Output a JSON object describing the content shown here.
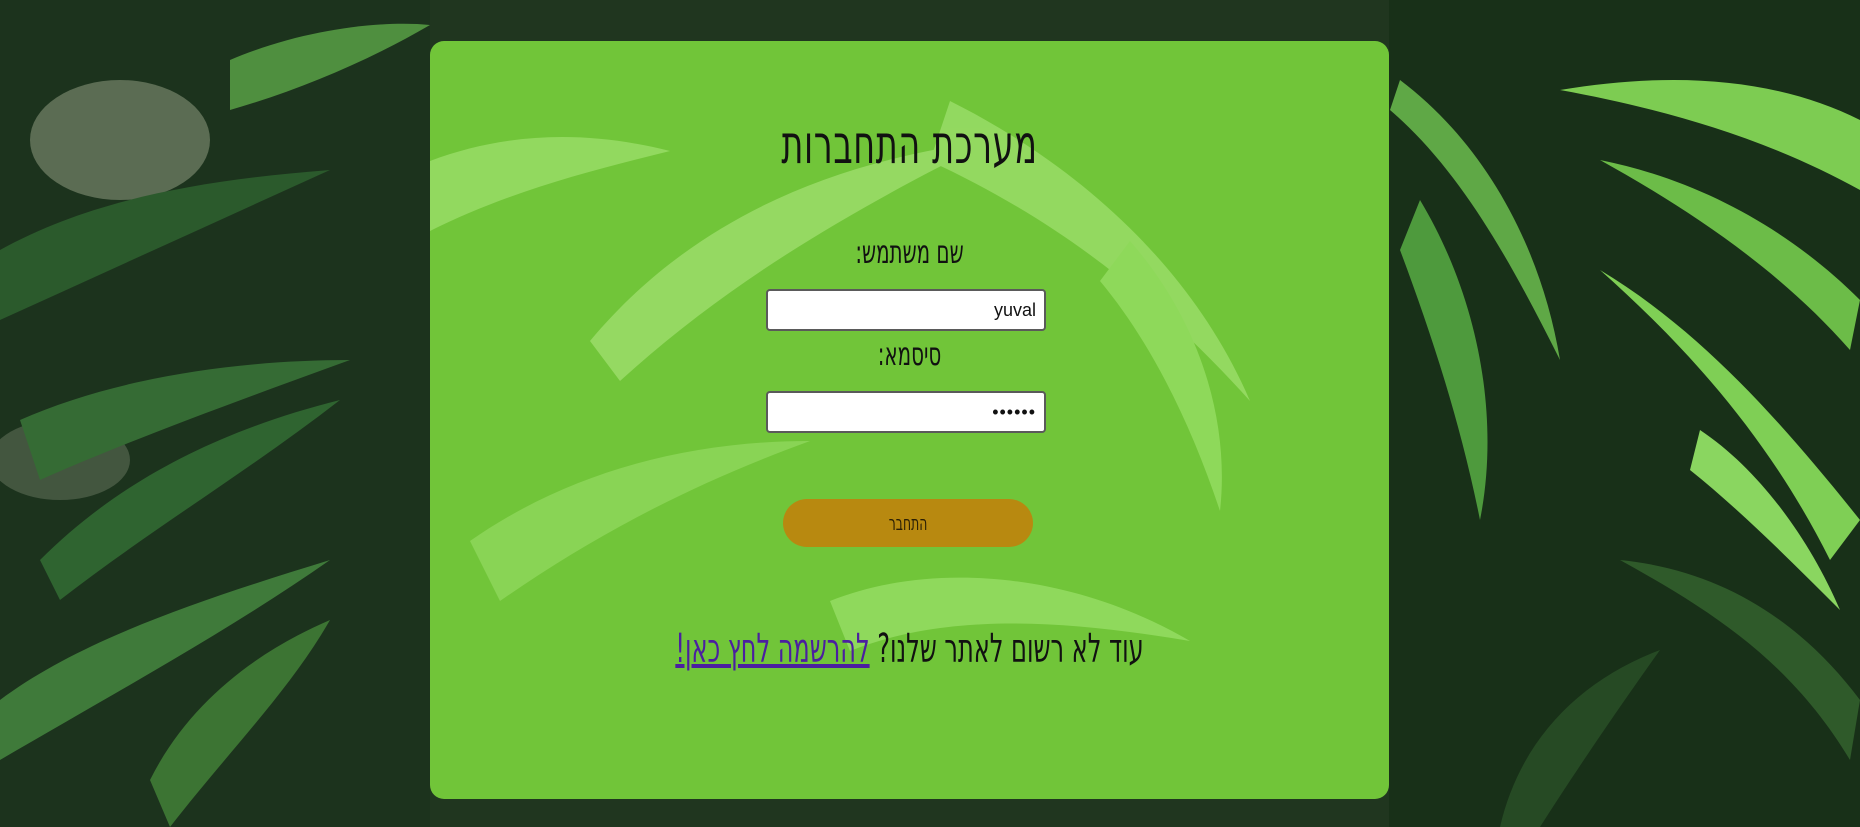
{
  "login": {
    "title": "מערכת התחברות",
    "username_label": "שם משתמש:",
    "username_value": "yuval",
    "password_label": "סיסמא:",
    "password_value": "••••••",
    "submit_label": "התחבר",
    "register_prompt": "עוד לא רשום לאתר שלנו? ",
    "register_link": "להרשמה לחץ כאן!"
  },
  "colors": {
    "panel": "#7cda3e",
    "button": "#b88910",
    "link": "#4b1fa0",
    "background": "#1f3a22"
  }
}
